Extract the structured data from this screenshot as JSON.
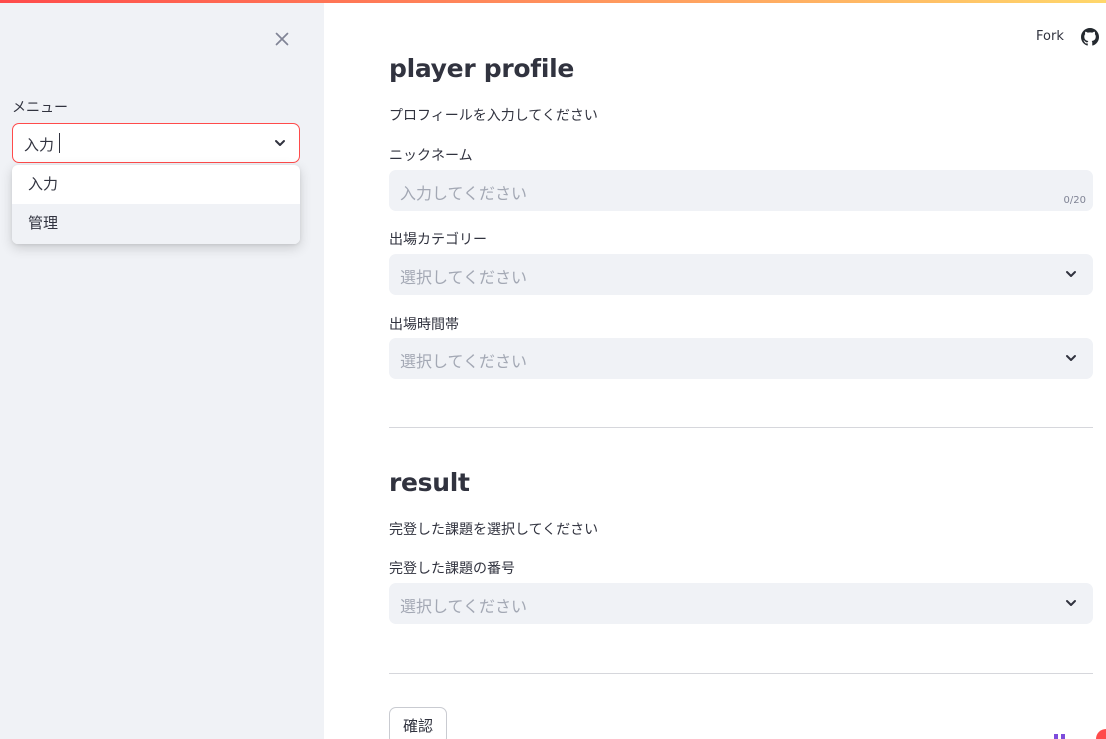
{
  "sidebar": {
    "menu_label": "メニュー",
    "selected_value": "入力",
    "options": [
      "入力",
      "管理"
    ]
  },
  "header": {
    "fork_label": "Fork",
    "github_icon": "github-icon"
  },
  "profile": {
    "title": "player profile",
    "subtitle": "プロフィールを入力してください",
    "nickname_label": "ニックネーム",
    "nickname_placeholder": "入力してください",
    "nickname_counter": "0/20",
    "category_label": "出場カテゴリー",
    "category_placeholder": "選択してください",
    "timeslot_label": "出場時間帯",
    "timeslot_placeholder": "選択してください"
  },
  "result": {
    "title": "result",
    "subtitle": "完登した課題を選択してください",
    "problem_label": "完登した課題の番号",
    "problem_placeholder": "選択してください"
  },
  "confirm_label": "確認",
  "colors": {
    "accent": "#ff4b4b",
    "sidebar_bg": "#f0f2f6",
    "text": "#31333f",
    "placeholder": "#a3a8b4"
  }
}
